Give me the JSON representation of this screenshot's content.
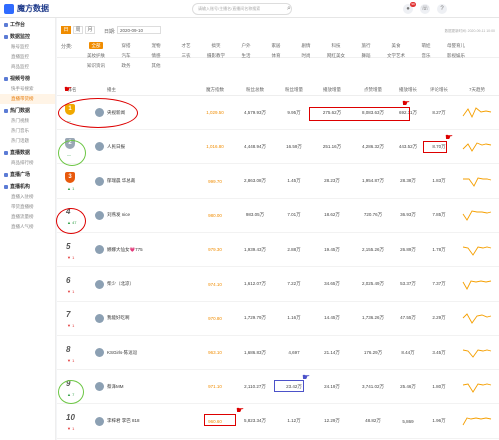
{
  "app": {
    "logo_text": "魔方数据",
    "search_placeholder": "请输入账号/主播名/直播间名称搜索",
    "notif_badge": "99"
  },
  "sidebar": {
    "groups": [
      {
        "label": "工作台",
        "items": []
      },
      {
        "label": "数据监控",
        "items": [
          "账号监控",
          "直播监控",
          "商品监控"
        ]
      },
      {
        "label": "视频号榜",
        "items": [
          "快手号搜索",
          "直播带货榜"
        ]
      },
      {
        "label": "热门数据",
        "items": [
          "热门视频",
          "热门音乐",
          "热门话题"
        ]
      },
      {
        "label": "直播数据",
        "items": [
          "商品排行榜"
        ]
      },
      {
        "label": "直播广场",
        "items": []
      },
      {
        "label": "直播机构",
        "items": [
          "直播入驻榜",
          "带货直播榜",
          "直播流量榜",
          "直播人气榜"
        ]
      }
    ],
    "active_item": "直播带货榜"
  },
  "controls": {
    "periods": [
      "日",
      "周",
      "月"
    ],
    "active_period": "日",
    "date_label": "日期:",
    "date_value": "2020-09-10",
    "update_note": "数据更新时间: 2020-09-11 10:00",
    "category_label": "分类:",
    "categories": [
      "全部",
      "穿搭",
      "宠物",
      "才艺",
      "搞笑",
      "户外",
      "家居",
      "剧情",
      "科技",
      "旅行",
      "美食",
      "萌娃",
      "母婴育儿",
      "美妆护肤",
      "汽车",
      "情感",
      "三农",
      "摄影教学",
      "生活",
      "体育",
      "时尚",
      "网红美女",
      "舞蹈",
      "文学艺术",
      "音乐",
      "影视娱乐",
      "知识资讯",
      "政务",
      "其他"
    ],
    "active_category": "全部"
  },
  "table": {
    "headers": [
      "排名",
      "播主",
      "魔方指数",
      "粉丝总数",
      "粉丝增量",
      "播放增量",
      "点赞增量",
      "播放增长",
      "评论增长",
      "7天趋势"
    ],
    "rows": [
      {
        "rank": "1",
        "change": "—",
        "name": "央视新闻",
        "rating": "1,029.50",
        "fans_total": "4,579.93万",
        "fans_inc": "9.95万",
        "play_inc": "275.62万",
        "like_inc": "8,083.63万",
        "play_growth": "692.11万",
        "comment_growth": "8.27万"
      },
      {
        "rank": "2",
        "change": "—",
        "name": "人民日报",
        "rating": "1,016.80",
        "fans_total": "4,448.94万",
        "fans_inc": "16.59万",
        "play_inc": "251.16万",
        "like_inc": "4,286.32万",
        "play_growth": "443.52万",
        "comment_growth": "8.70万"
      },
      {
        "rank": "3",
        "change": "▲ 1",
        "name": "郁瑞晨 华总裁",
        "rating": "999.70",
        "fans_total": "2,863.08万",
        "fans_inc": "1.45万",
        "play_inc": "28.23万",
        "like_inc": "1,954.87万",
        "play_growth": "28.38万",
        "comment_growth": "1.83万"
      },
      {
        "rank": "4",
        "change": "▲ 47",
        "name": "刘燕发 nice",
        "rating": "980.00",
        "fans_total": "983.05万",
        "fans_inc": "7.01万",
        "play_inc": "18.62万",
        "like_inc": "720.76万",
        "play_growth": "36.93万",
        "comment_growth": "7.85万"
      },
      {
        "rank": "5",
        "change": "▼ 1",
        "name": "娜娜大仙女💗775",
        "rating": "979.30",
        "fans_total": "1,939.43万",
        "fans_inc": "2.88万",
        "play_inc": "19.45万",
        "like_inc": "2,155.26万",
        "play_growth": "26.89万",
        "comment_growth": "1.78万"
      },
      {
        "rank": "6",
        "change": "▼ 1",
        "name": "柴少（北凉）",
        "rating": "974.10",
        "fans_total": "1,612.07万",
        "fans_inc": "7.22万",
        "play_inc": "34.65万",
        "like_inc": "2,025.49万",
        "play_growth": "53.37万",
        "comment_growth": "7.37万"
      },
      {
        "rank": "7",
        "change": "▼ 1",
        "name": "我能好吃啊",
        "rating": "970.80",
        "fans_total": "1,729.79万",
        "fans_inc": "1.16万",
        "play_inc": "14.45万",
        "like_inc": "1,736.26万",
        "play_growth": "47.55万",
        "comment_growth": "2.29万"
      },
      {
        "rank": "8",
        "change": "▼ 1",
        "name": "KSGirls-陈逗逗",
        "rating": "963.10",
        "fans_total": "1,686.83万",
        "fans_inc": "4,697",
        "play_inc": "21.14万",
        "like_inc": "176.29万",
        "play_growth": "8.44万",
        "comment_growth": "3.45万"
      },
      {
        "rank": "9",
        "change": "▲ 7",
        "name": "蔡泽MM",
        "rating": "971.10",
        "fans_total": "2,110.27万",
        "fans_inc": "23.42万",
        "play_inc": "24.19万",
        "like_inc": "3,741.02万",
        "play_growth": "25.46万",
        "comment_growth": "1.80万"
      },
      {
        "rank": "10",
        "change": "▼ 1",
        "name": "李梓君 李巴 818",
        "rating": "960.60",
        "fans_total": "5,823.34万",
        "fans_inc": "1.12万",
        "play_inc": "12.29万",
        "like_inc": "48.82万",
        "play_growth": "5,869",
        "comment_growth": "1.96万"
      }
    ]
  },
  "colors": {
    "accent": "#f08c00",
    "annotation_red": "#dd0000",
    "annotation_green": "#6cc644",
    "annotation_blue": "#4c52c9"
  }
}
